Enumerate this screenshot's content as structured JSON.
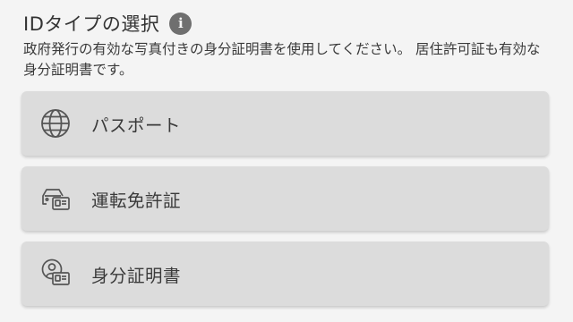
{
  "header": {
    "title": "IDタイプの選択",
    "info_glyph": "i"
  },
  "subtitle": "政府発行の有効な写真付きの身分証明書を使用してください。 居住許可証も有効な身分証明書です。",
  "options": [
    {
      "label": "パスポート",
      "icon": "globe-icon"
    },
    {
      "label": "運転免許証",
      "icon": "car-license-icon"
    },
    {
      "label": "身分証明書",
      "icon": "id-card-person-icon"
    }
  ],
  "colors": {
    "background": "#f4f4f4",
    "card": "#dcdcdc",
    "text": "#333333",
    "icon": "#555555"
  }
}
